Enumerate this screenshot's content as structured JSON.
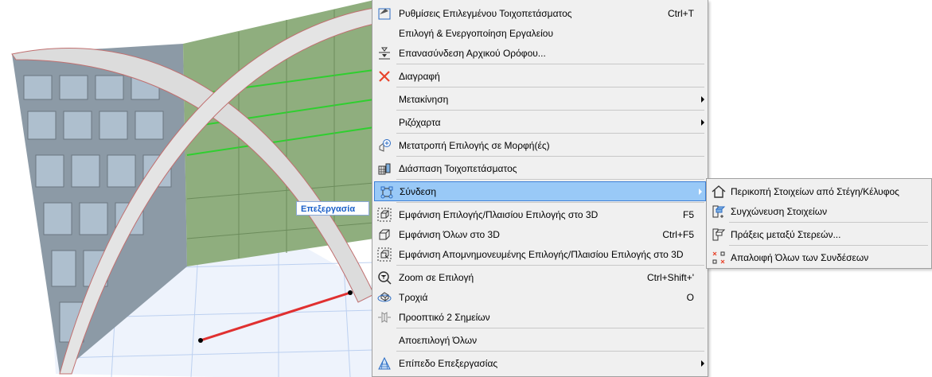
{
  "canvas": {
    "edit_tag": "Επεξεργασία"
  },
  "menu": {
    "items": [
      {
        "label": "Ρυθμίσεις Επιλεγμένου Τοιχοπετάσματος",
        "shortcut": "Ctrl+T",
        "icon": "settings-icon"
      },
      {
        "label": "Επιλογή & Ενεργοποίηση Εργαλείου"
      },
      {
        "label": "Επανασύνδεση Αρχικού Ορόφου...",
        "icon": "story-icon"
      },
      {
        "label": "Διαγραφή",
        "icon": "delete-icon"
      },
      {
        "label": "Μετακίνηση",
        "submenu": true
      },
      {
        "label": "Ριζόχαρτα",
        "submenu": true
      },
      {
        "label": "Μετατροπή Επιλογής σε Μορφή(ές)",
        "icon": "morph-icon"
      },
      {
        "label": "Διάσπαση Τοιχοπετάσματος",
        "icon": "explode-icon"
      },
      {
        "label": "Σύνδεση",
        "submenu": true,
        "highlighted": true,
        "icon": "connect-icon"
      },
      {
        "label": "Εμφάνιση Επιλογής/Πλαισίου Επιλογής στο 3D",
        "shortcut": "F5",
        "icon": "show-selection-3d-icon"
      },
      {
        "label": "Εμφάνιση Όλων στο 3D",
        "shortcut": "Ctrl+F5",
        "icon": "show-all-3d-icon"
      },
      {
        "label": "Εμφάνιση Απομνημονευμένης Επιλογής/Πλαισίου Επιλογής στο 3D",
        "icon": "show-stored-3d-icon"
      },
      {
        "label": "Zoom σε Επιλογή",
        "shortcut": "Ctrl+Shift+'",
        "icon": "zoom-icon"
      },
      {
        "label": "Τροχιά",
        "shortcut": "O",
        "icon": "orbit-icon"
      },
      {
        "label": "Προοπτικό 2 Σημείων",
        "icon": "two-point-perspective-icon"
      },
      {
        "label": "Αποεπιλογή Όλων"
      },
      {
        "label": "Επίπεδο Επεξεργασίας",
        "submenu": true,
        "icon": "editing-plane-icon"
      }
    ]
  },
  "submenu": {
    "items": [
      {
        "label": "Περικοπή Στοιχείων από Στέγη/Κέλυφος",
        "icon": "trim-roof-icon"
      },
      {
        "label": "Συγχώνευση Στοιχείων",
        "icon": "merge-icon"
      },
      {
        "label": "Πράξεις μεταξύ Στερεών...",
        "icon": "solid-operations-icon"
      },
      {
        "label": "Απαλοιφή Όλων των Συνδέσεων",
        "icon": "clear-connections-icon"
      }
    ]
  },
  "colors": {
    "highlight": "#99c9f7",
    "delete": "#e8432a",
    "accent": "#1a5fc8"
  }
}
